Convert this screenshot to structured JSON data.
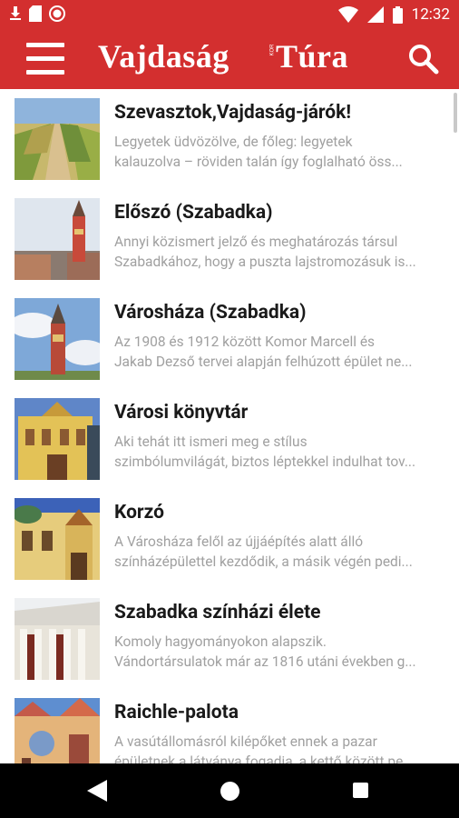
{
  "status_bar": {
    "time": "12:32"
  },
  "app_bar": {
    "logo_left": "Vajdaság",
    "logo_right": "Túra",
    "logo_small": "KOR"
  },
  "items": [
    {
      "title": "Szevasztok,Vajdaság-járók!",
      "desc_line1": "Legyetek üdvözölve, de főleg: legyetek",
      "desc_line2": "kalauzolva – röviden talán  így  foglalható  öss..."
    },
    {
      "title": "Előszó (Szabadka)",
      "desc_line1": "Annyi közismert jelző és meghatározás társul",
      "desc_line2": "Szabadkához, hogy a puszta lajstromozásuk is..."
    },
    {
      "title": "Városháza (Szabadka)",
      "desc_line1": "Az 1908 és 1912 között Komor Marcell és",
      "desc_line2": "Jakab Dezső tervei alapján felhúzott épület ne..."
    },
    {
      "title": "Városi könyvtár",
      "desc_line1": "Aki tehát itt ismeri meg e stílus",
      "desc_line2": "szimbólumvilágát, biztos léptekkel indulhat tov..."
    },
    {
      "title": "Korzó",
      "desc_line1": "A Városháza felől az újjáépítés alatt álló",
      "desc_line2": "színházépülettel kezdődik, a másik végén pedi..."
    },
    {
      "title": "Szabadka színházi élete",
      "desc_line1": "Komoly hagyományokon alapszik.",
      "desc_line2": "Vándortársulatok már az 1816 utáni években g..."
    },
    {
      "title": "Raichle-palota",
      "desc_line1": "A vasútállomásról kilépőket ennek a pazar",
      "desc_line2": "épületnek a látványa fogadja, a kettő között pe..."
    }
  ],
  "colors": {
    "primary": "#d32f2f",
    "title": "#1a1a1a",
    "desc": "#a0a0a0"
  }
}
